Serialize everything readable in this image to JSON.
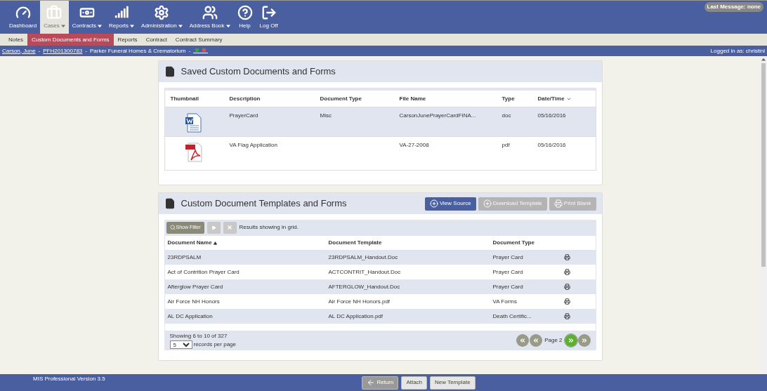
{
  "nav": {
    "items": [
      {
        "label": "Dashboard",
        "dropdown": false,
        "selected": false
      },
      {
        "label": "Cases",
        "dropdown": true,
        "selected": true
      },
      {
        "label": "Contracts",
        "dropdown": true,
        "selected": false
      },
      {
        "label": "Reports",
        "dropdown": true,
        "selected": false
      },
      {
        "label": "Administration",
        "dropdown": true,
        "selected": false
      },
      {
        "label": "Address Book",
        "dropdown": true,
        "selected": false
      },
      {
        "label": "Help",
        "dropdown": false,
        "selected": false
      },
      {
        "label": "Log Off",
        "dropdown": false,
        "selected": false
      }
    ],
    "last_message": "Last Message: none"
  },
  "subnav": [
    {
      "label": "Notes",
      "selected": false
    },
    {
      "label": "Custom Documents and Forms",
      "selected": true
    },
    {
      "label": "Reports",
      "selected": false
    },
    {
      "label": "Contract",
      "selected": false
    },
    {
      "label": "Contract Summary",
      "selected": false
    }
  ],
  "breadcrumb": {
    "parts": [
      {
        "kind": "link",
        "text": "Carson, June"
      },
      {
        "kind": "text",
        "text": "-"
      },
      {
        "kind": "link",
        "text": "PFH201300783"
      },
      {
        "kind": "text",
        "text": "-"
      },
      {
        "kind": "text",
        "text": "Parker Funeral Homes & Crematorium"
      },
      {
        "kind": "text",
        "text": "-"
      }
    ],
    "status": [
      {
        "color": "#3aa33a"
      },
      {
        "color": "#d9534f"
      }
    ],
    "logged_in": "Logged in as: christinl"
  },
  "saved": {
    "title": "Saved Custom Documents and Forms",
    "columns": [
      "Thumbnail",
      "Description",
      "Document Type",
      "File Name",
      "Type",
      "Date/Time"
    ],
    "rows": [
      {
        "kind": "word",
        "selected": true,
        "description": "PrayerCard",
        "document_type": "Misc",
        "file_name": "CarsonJunePrayerCardFINA...",
        "file_type": "doc",
        "date": "05/16/2016"
      },
      {
        "kind": "pdf",
        "selected": false,
        "description": "VA Flag Application",
        "file_name": "VA-27-2008",
        "file_type": "pdf",
        "date": "05/16/2016"
      }
    ]
  },
  "templates": {
    "title": "Custom Document Templates and Forms",
    "actions": [
      {
        "label": "View Source",
        "disabled": false
      },
      {
        "label": "Download Template",
        "disabled": true
      },
      {
        "label": "Print Blank",
        "disabled": true
      }
    ],
    "filter_button": "Show Filter",
    "filter_status": "Results showing in grid.",
    "columns": [
      "Document Name",
      "Document Template",
      "Document Type"
    ],
    "rows": [
      {
        "name": "23RDPSALM",
        "template": "23RDPSALM_Handout.Doc",
        "document_type": "Prayer Card"
      },
      {
        "name": "Act of Contrition Prayer Card",
        "template": "ACTCONTRIT_Handout.Doc",
        "document_type": "Prayer Card"
      },
      {
        "name": "Afterglow Prayer Card",
        "template": "AFTERGLOW_Handout.Doc",
        "document_type": "Prayer Card"
      },
      {
        "name": "Air Force NH Honors",
        "template": "Air Force NH Honors.pdf",
        "document_type": "VA Forms"
      },
      {
        "name": "AL DC Application",
        "template": "AL DC Application.pdf",
        "document_type": "Death Certific..."
      }
    ],
    "showing": "Showing 6 to 10 of 327",
    "per_page": "5",
    "per_page_label": "records per page",
    "page": "Page 2"
  },
  "footer": {
    "version": "MIS Professional Version 3.5",
    "buttons": [
      {
        "label": "Return",
        "disabled": true
      },
      {
        "label": "Attach",
        "disabled": false
      },
      {
        "label": "New Template",
        "disabled": false
      }
    ]
  }
}
